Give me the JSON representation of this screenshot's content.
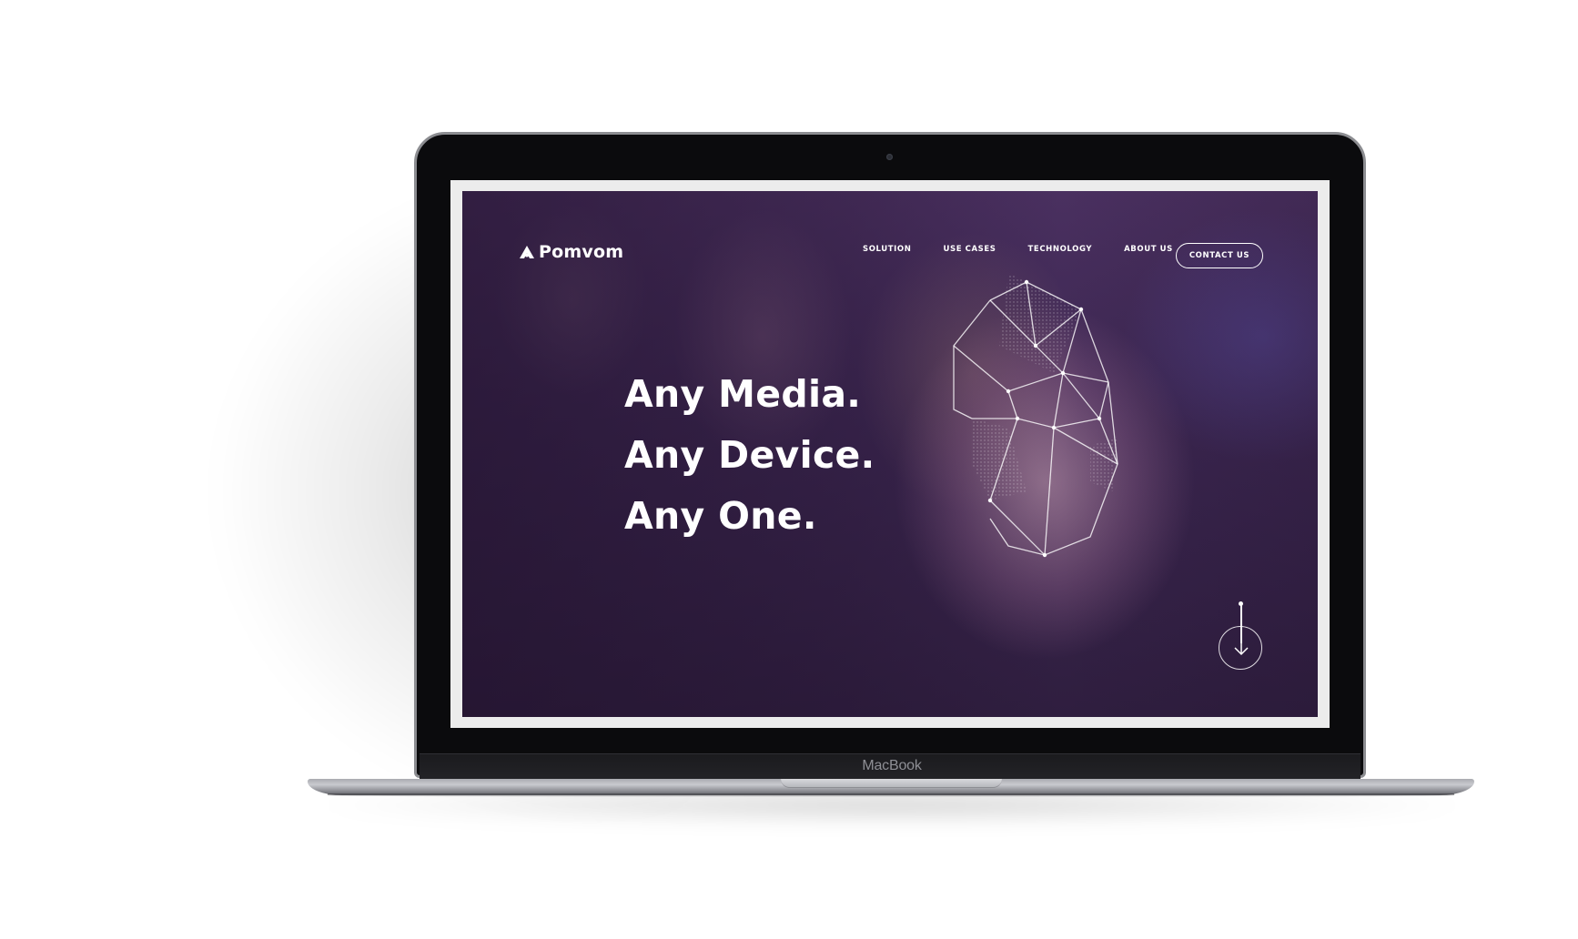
{
  "device": {
    "brand_label": "MacBook"
  },
  "site": {
    "logo_text": "Pomvom",
    "nav": {
      "items": [
        "SOLUTION",
        "USE CASES",
        "TECHNOLOGY",
        "ABOUT US"
      ],
      "cta_label": "CONTACT US"
    },
    "hero": {
      "lines": [
        "Any Media.",
        "Any Device.",
        "Any One."
      ]
    },
    "scroll_icon": "arrow-down-icon"
  },
  "colors": {
    "overlay_purple": "#3b2650",
    "text": "#ffffff"
  }
}
